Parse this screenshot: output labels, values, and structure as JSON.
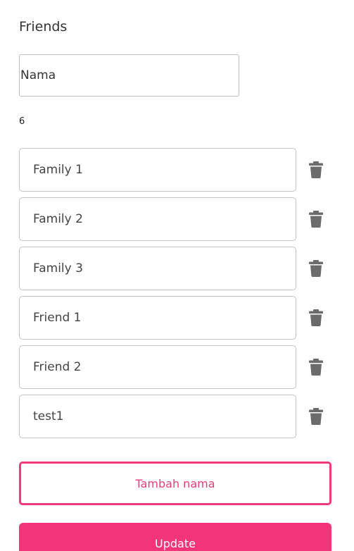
{
  "header": {
    "title": "Friends"
  },
  "form": {
    "name_placeholder": "Nama",
    "name_value": ""
  },
  "count": "6",
  "items": [
    {
      "value": "Family 1"
    },
    {
      "value": "Family 2"
    },
    {
      "value": "Family 3"
    },
    {
      "value": "Friend 1"
    },
    {
      "value": "Friend 2"
    },
    {
      "value": "test1"
    }
  ],
  "icons": {
    "delete": "trash-icon"
  },
  "actions": {
    "add_label": "Tambah nama",
    "update_label": "Update"
  },
  "colors": {
    "accent": "#f2347a",
    "accent_outline": "#ee3a7c",
    "icon": "#6b6b6b"
  }
}
